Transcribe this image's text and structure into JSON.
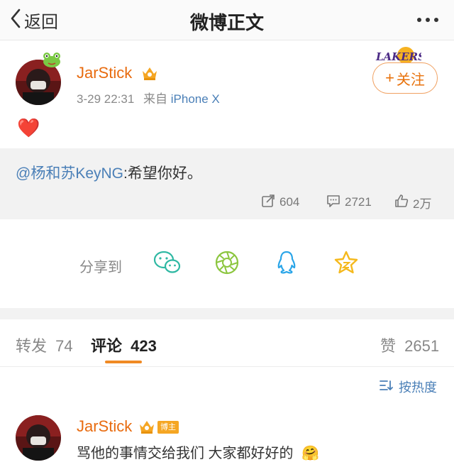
{
  "nav": {
    "back_label": "返回",
    "title": "微博正文"
  },
  "post": {
    "username": "JarStick",
    "time": "3-29 22:31",
    "source_prefix": "来自",
    "source": "iPhone X",
    "follow_label": "关注",
    "follow_plus": "+",
    "content_emoji": "❤️",
    "lakers_logo_text": "LAKERS"
  },
  "retweet": {
    "mention": "@杨和苏KeyNG",
    "text": ":希望你好。",
    "share_count": "604",
    "comment_count": "2721",
    "like_count": "2万"
  },
  "share": {
    "label": "分享到"
  },
  "tabs": {
    "repost_label": "转发",
    "repost_count": "74",
    "comment_label": "评论",
    "comment_count": "423",
    "like_label": "赞",
    "like_count": "2651"
  },
  "sort": {
    "label": "按热度"
  },
  "comment": {
    "username": "JarStick",
    "badge": "博主",
    "text": "骂他的事情交给我们 大家都好好的",
    "emoji": "🤗"
  },
  "colors": {
    "accent": "#e86b0f",
    "link": "#4a7fb7",
    "tab_underline": "#f08a24"
  }
}
